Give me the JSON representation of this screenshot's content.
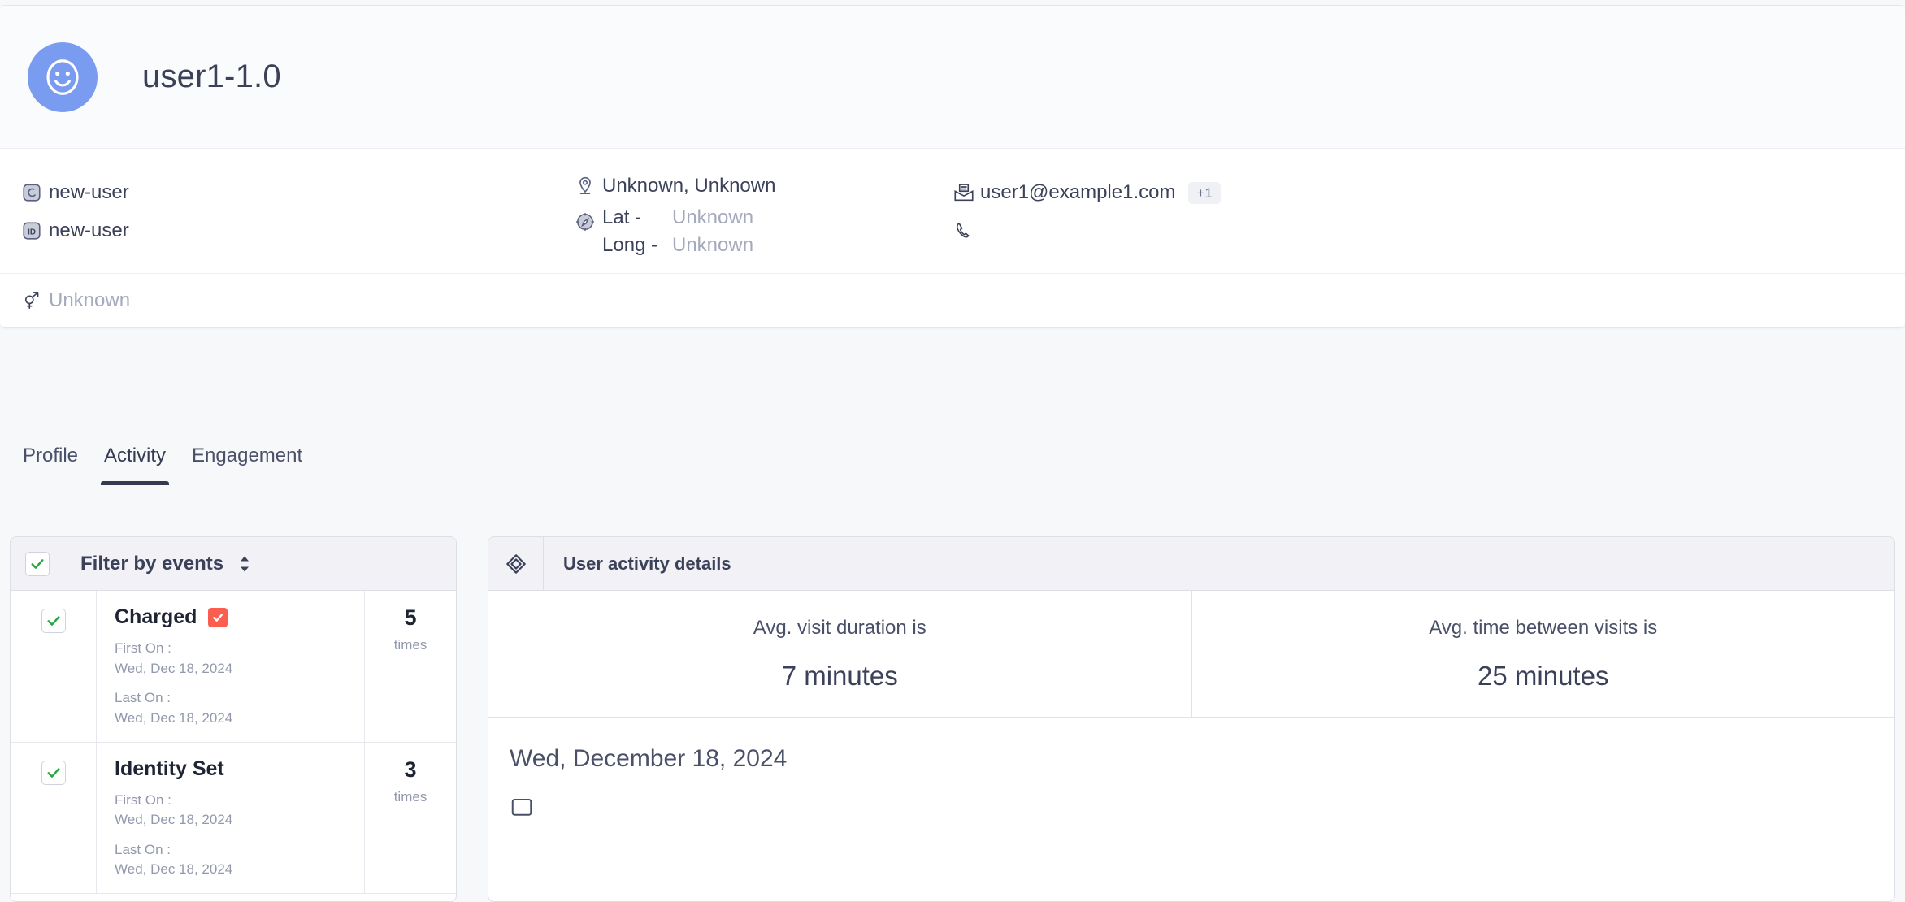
{
  "profile": {
    "avatar_icon": "smiley-face-icon",
    "name": "user1-1.0",
    "identity_rows": [
      {
        "icon": "moon-identity-icon",
        "label": "new-user"
      },
      {
        "icon": "id-badge-icon",
        "label": "new-user"
      }
    ],
    "location": {
      "place_icon": "map-pin-icon",
      "place": "Unknown, Unknown",
      "compass_icon": "compass-icon",
      "lat_label": "Lat -",
      "lat_value": "Unknown",
      "long_label": "Long -",
      "long_value": "Unknown"
    },
    "contact": {
      "email_icon": "email-open-icon",
      "email": "user1@example1.com",
      "email_more_badge": "+1",
      "phone_icon": "phone-icon",
      "phone": ""
    },
    "gender": {
      "icon": "gender-icon",
      "value": "Unknown"
    }
  },
  "tabs": [
    {
      "label": "Profile",
      "active": false
    },
    {
      "label": "Activity",
      "active": true
    },
    {
      "label": "Engagement",
      "active": false
    }
  ],
  "filter_panel": {
    "header": {
      "checkbox_checked": true,
      "title": "Filter by events",
      "sort_icon": "sort-updown-icon"
    },
    "events": [
      {
        "checked": true,
        "name": "Charged",
        "flag_icon": "checked-flag-icon",
        "first_on_label": "First On :",
        "first_on_value": "Wed, Dec 18, 2024",
        "last_on_label": "Last On :",
        "last_on_value": "Wed, Dec 18, 2024",
        "count": "5",
        "count_unit": "times"
      },
      {
        "checked": true,
        "name": "Identity Set",
        "flag_icon": "",
        "first_on_label": "First On :",
        "first_on_value": "Wed, Dec 18, 2024",
        "last_on_label": "Last On :",
        "last_on_value": "Wed, Dec 18, 2024",
        "count": "3",
        "count_unit": "times"
      }
    ]
  },
  "details_panel": {
    "header": {
      "icon": "ticket-tag-icon",
      "title": "User activity details"
    },
    "stats": [
      {
        "label": "Avg. visit duration is",
        "value": "7 minutes"
      },
      {
        "label": "Avg. time between visits is",
        "value": "25 minutes"
      }
    ],
    "date_heading": "Wed, December 18, 2024"
  },
  "colors": {
    "avatar_bg": "#7a9cf0",
    "accent_dark": "#343a52",
    "checkbox_green": "#2aa545",
    "flag_red": "#fb5e4f",
    "panel_header_bg": "#f1f1f6",
    "muted_text": "#a4a9bd"
  }
}
